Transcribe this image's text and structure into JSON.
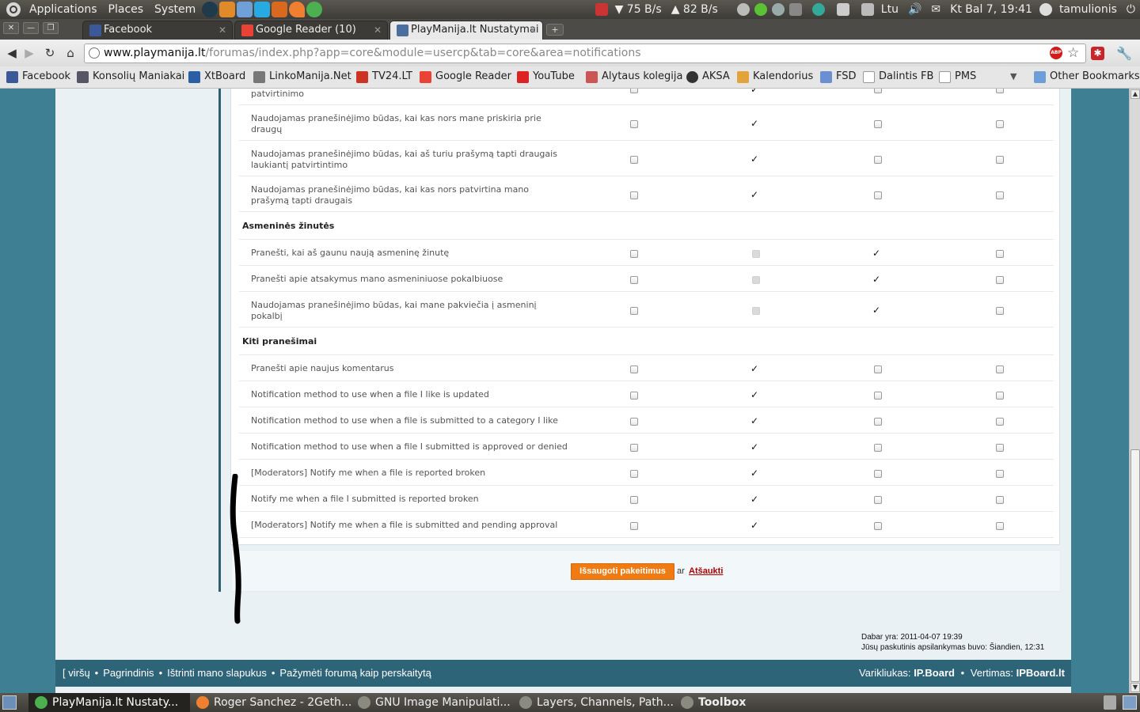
{
  "top_panel": {
    "menus": [
      "Applications",
      "Places",
      "System"
    ],
    "download_speed": "75 B/s",
    "upload_speed": "82 B/s",
    "keyboard_layout": "Ltu",
    "datetime": "Kt Bal 7, 19:41",
    "username": "tamulionis"
  },
  "tabs": [
    {
      "title": "Facebook",
      "active": false
    },
    {
      "title": "Google Reader (10)",
      "active": false
    },
    {
      "title": "PlayManija.lt Nustatymai",
      "active": true
    }
  ],
  "address_bar": {
    "host": "www.playmanija.lt",
    "path": "/forumas/index.php?app=core&module=usercp&tab=core&area=notifications"
  },
  "bookmarks": [
    "Facebook",
    "Konsolių Maniakai",
    "XtBoard",
    "LinkoManija.Net",
    "TV24.LT",
    "Google Reader",
    "YouTube",
    "Alytaus kolegija",
    "AKSA",
    "Kalendorius",
    "FSD",
    "Dalintis FB",
    "PMS"
  ],
  "other_bookmarks": "Other Bookmarks",
  "notifications": {
    "partial_row": {
      "label": "patvirtinimo",
      "checks": [
        false,
        true,
        false,
        false
      ]
    },
    "rows_group1": [
      {
        "label": "Naudojamas pranešinėjimo būdas, kai kas nors mane priskiria prie draugų",
        "checks": [
          false,
          true,
          false,
          false
        ]
      },
      {
        "label": "Naudojamas pranešinėjimo būdas, kai aš turiu prašymą tapti draugais laukiantį patvirtintimo",
        "checks": [
          false,
          true,
          false,
          false
        ]
      },
      {
        "label": "Naudojamas pranešinėjimo būdas, kai kas nors patvirtina mano prašymą tapti draugais",
        "checks": [
          false,
          true,
          false,
          false
        ]
      }
    ],
    "section_pm": "Asmeninės žinutės",
    "rows_pm": [
      {
        "label": "Pranešti, kai aš gaunu naują asmeninę žinutę",
        "checks": [
          false,
          false,
          true,
          false
        ],
        "disabled": [
          false,
          true,
          false,
          false
        ]
      },
      {
        "label": "Pranešti apie atsakymus mano asmeniniuose pokalbiuose",
        "checks": [
          false,
          false,
          true,
          false
        ],
        "disabled": [
          false,
          true,
          false,
          false
        ]
      },
      {
        "label": "Naudojamas pranešinėjimo būdas, kai mane pakviečia į asmeninį pokalbį",
        "checks": [
          false,
          false,
          true,
          false
        ],
        "disabled": [
          false,
          true,
          false,
          false
        ]
      }
    ],
    "section_other": "Kiti pranešimai",
    "rows_other": [
      {
        "label": "Pranešti apie naujus komentarus",
        "checks": [
          false,
          true,
          false,
          false
        ]
      },
      {
        "label": "Notification method to use when a file I like is updated",
        "checks": [
          false,
          true,
          false,
          false
        ]
      },
      {
        "label": "Notification method to use when a file is submitted to a category I like",
        "checks": [
          false,
          true,
          false,
          false
        ]
      },
      {
        "label": "Notification method to use when a file I submitted is approved or denied",
        "checks": [
          false,
          true,
          false,
          false
        ]
      },
      {
        "label": "[Moderators] Notify me when a file is reported broken",
        "checks": [
          false,
          true,
          false,
          false
        ]
      },
      {
        "label": "Notify me when a file I submitted is reported broken",
        "checks": [
          false,
          true,
          false,
          false
        ]
      },
      {
        "label": "[Moderators] Notify me when a file is submitted and pending approval",
        "checks": [
          false,
          true,
          false,
          false
        ]
      }
    ]
  },
  "form_actions": {
    "save_label": "Išsaugoti pakeitimus",
    "or_text": "ar",
    "cancel_label": "Atšaukti"
  },
  "time_info": {
    "now": "Dabar yra: 2011-04-07 19:39",
    "last_visit": "Jūsų paskutinis apsilankymas buvo: Šiandien, 12:31"
  },
  "footer": {
    "links": [
      "[ viršų",
      "Pagrindinis",
      "Ištrinti mano slapukus",
      "Pažymėti forumą kaip perskaitytą"
    ],
    "engine_label": "Varikliukas:",
    "engine_value": "IP.Board",
    "translation_label": "Vertimas:",
    "translation_value": "IPBoard.lt"
  },
  "taskbar": [
    {
      "title": "PlayManija.lt Nustaty...",
      "active": true
    },
    {
      "title": "Roger Sanchez - 2Geth...",
      "active": false
    },
    {
      "title": "GNU Image Manipulati...",
      "active": false
    },
    {
      "title": "Layers, Channels, Path...",
      "active": false
    },
    {
      "title": "Toolbox",
      "active": false
    }
  ]
}
